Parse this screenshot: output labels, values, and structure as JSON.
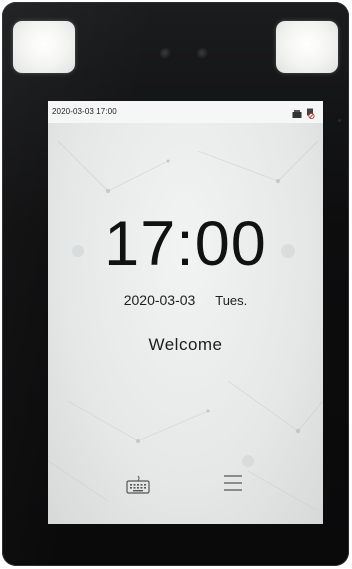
{
  "status_bar": {
    "datetime": "2020-03-03 17:00",
    "icons": [
      "network-icon",
      "usb-disconnected-icon"
    ]
  },
  "main": {
    "time": "17:00",
    "date": "2020-03-03",
    "weekday": "Tues.",
    "greeting": "Welcome"
  },
  "bottom_bar": {
    "icons": [
      "keyboard-icon",
      "menu-icon"
    ]
  },
  "colors": {
    "bezel": "#0d0d0e",
    "screen": "#e6e8e8",
    "text": "#111111",
    "ir_light": "#f3f4f2"
  }
}
